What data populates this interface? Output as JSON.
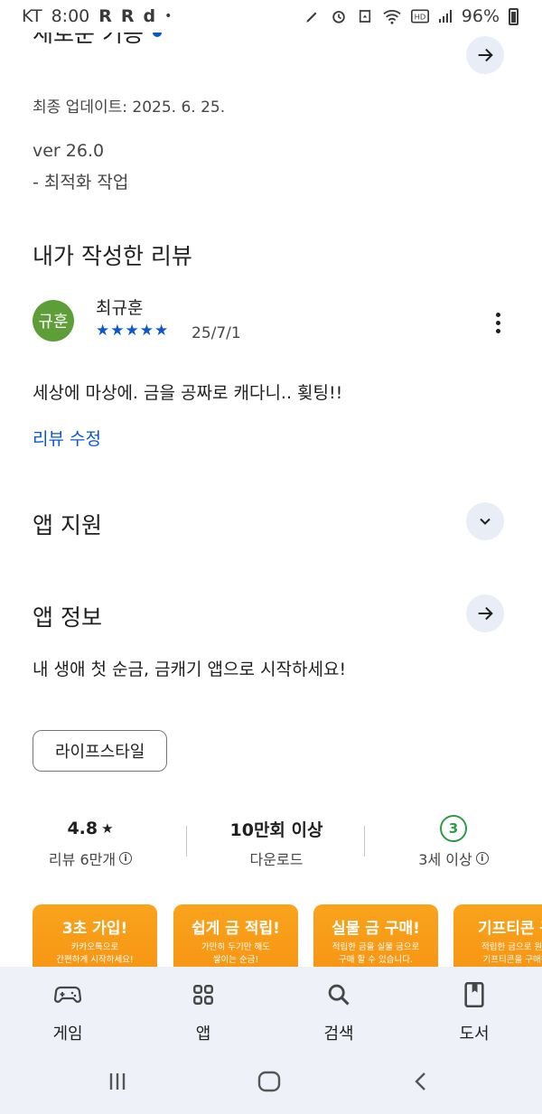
{
  "status_bar": {
    "carrier": "KT",
    "time": "8:00",
    "notif_glyphs": [
      "R",
      "R",
      "d",
      "•"
    ],
    "battery": "96%"
  },
  "whats_new": {
    "title": "새로운 기능",
    "updated": "최종 업데이트: 2025. 6. 25.",
    "version": "ver 26.0",
    "note": "- 최적화 작업"
  },
  "my_review": {
    "section_title": "내가 작성한 리뷰",
    "author": "최규훈",
    "avatar_text": "규훈",
    "stars": "★★★★★",
    "date": "25/7/1",
    "text": "세상에 마상에. 금을 공짜로 캐다니.. 횢팅!!",
    "edit_link": "리뷰 수정"
  },
  "app_support": {
    "title": "앱 지원"
  },
  "app_info": {
    "title": "앱 정보",
    "description": "내 생애 첫 순금, 금캐기 앱으로 시작하세요!",
    "category_chip": "라이프스타일"
  },
  "stats": {
    "rating": "4.8",
    "rating_star": "★",
    "reviews": "리뷰 6만개",
    "downloads": "10만회 이상",
    "downloads_label": "다운로드",
    "age_badge": "3",
    "age_label": "3세 이상"
  },
  "screenshots": [
    {
      "title": "3초 가입!",
      "sub1": "카카오톡으로",
      "sub2": "간편하게 시작하세요!"
    },
    {
      "title": "쉽게 금 적립!",
      "sub1": "가만히 두기만 해도",
      "sub2": "쌓이는 순금!"
    },
    {
      "title": "실물 금 구매!",
      "sub1": "적립한 금을 실물 금으로",
      "sub2": "구매 할 수 있습니다."
    },
    {
      "title": "기프티콘 구",
      "sub1": "적립한 금으로 원하",
      "sub2": "기프티콘을 구매하"
    }
  ],
  "bottom_nav": {
    "items": [
      {
        "label": "게임",
        "icon": "gamepad-icon"
      },
      {
        "label": "앱",
        "icon": "apps-grid-icon"
      },
      {
        "label": "검색",
        "icon": "search-icon"
      },
      {
        "label": "도서",
        "icon": "book-icon"
      }
    ]
  },
  "colors": {
    "accent": "#0b57d0",
    "avatar": "#5e9e39",
    "age_badge": "#2e9a46",
    "screenshot_bg": "#f7940f",
    "nav_bg": "#eef2f8"
  }
}
